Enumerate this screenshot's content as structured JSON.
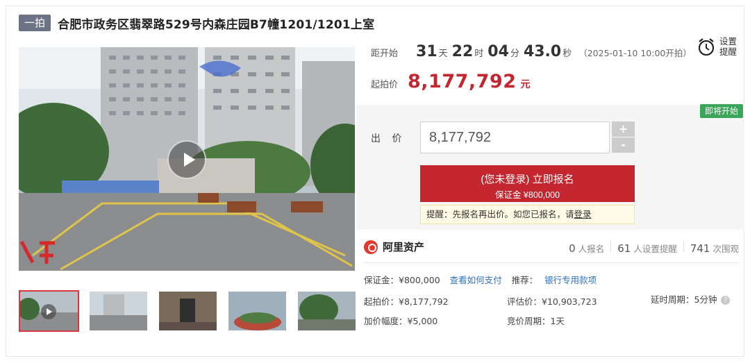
{
  "header": {
    "tag": "一拍",
    "title": "合肥市政务区翡翠路529号内森庄园B7幢1201/1201上室"
  },
  "countdown": {
    "label": "距开始",
    "days": "31",
    "days_unit": "天",
    "hours": "22",
    "hours_unit": "时",
    "minutes": "04",
    "minutes_unit": "分",
    "seconds": "43.0",
    "seconds_unit": "秒",
    "start_time": "（2025-01-10 10:00开拍）"
  },
  "reminder": {
    "label": "设置提醒",
    "icon": "alarm-clock-icon"
  },
  "start_price": {
    "label": "起拍价",
    "value": "8,177,792",
    "unit": "元"
  },
  "bid": {
    "badge": "即将开始",
    "label": "出 价",
    "input_value": "8,177,792",
    "plus": "+",
    "minus": "-",
    "signup_main": "(您未登录) 立即报名",
    "signup_sub": "保证金 ¥800,000",
    "tip_text": "提醒：先报名再出价。如您已报名，请",
    "tip_link": "登录"
  },
  "platform": {
    "name": "阿里资产",
    "signups_num": "0",
    "signups_lbl": "人报名",
    "reminders_num": "61",
    "reminders_lbl": "人设置提醒",
    "views_num": "741",
    "views_lbl": "次围观"
  },
  "details": {
    "deposit": "保证金：¥800,000",
    "how_to_pay": "查看如何支付",
    "recommend_label": "推荐：",
    "bank_link": "银行专用款项",
    "start_price": "起拍价：¥8,177,792",
    "appraisal": "评估价：¥10,903,723",
    "delay_period": "延时周期：5分钟",
    "increment": "加价幅度：¥5,000",
    "bid_period": "竞价周期：1天"
  },
  "colors": {
    "accent_red": "#c3262f",
    "badge_green": "#3aa65a",
    "link_blue": "#2c6fc9",
    "tag_gray": "#6b7385"
  }
}
